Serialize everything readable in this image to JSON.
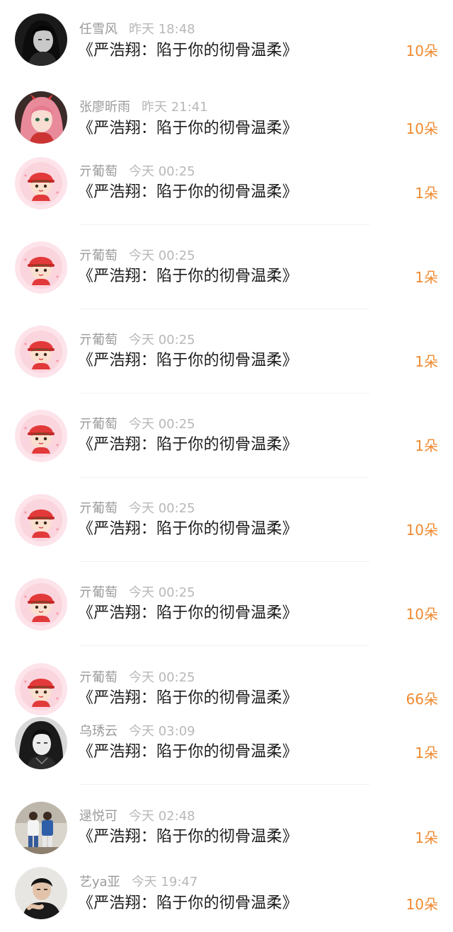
{
  "gift_list": {
    "items": [
      {
        "user": "任雪风",
        "time": "昨天 18:48",
        "title": "《严浩翔：陷于你的彻骨温柔》",
        "count": "10朵",
        "avatar": "dark-portrait"
      },
      {
        "user": "张廖昕雨",
        "time": "昨天 21:41",
        "title": "《严浩翔：陷于你的彻骨温柔》",
        "count": "10朵",
        "avatar": "anime-pink-hair"
      },
      {
        "user": "亓葡萄",
        "time": "今天 00:25",
        "title": "《严浩翔：陷于你的彻骨温柔》",
        "count": "1朵",
        "avatar": "cartoon-red-cap"
      },
      {
        "user": "亓葡萄",
        "time": "今天 00:25",
        "title": "《严浩翔：陷于你的彻骨温柔》",
        "count": "1朵",
        "avatar": "cartoon-red-cap"
      },
      {
        "user": "亓葡萄",
        "time": "今天 00:25",
        "title": "《严浩翔：陷于你的彻骨温柔》",
        "count": "1朵",
        "avatar": "cartoon-red-cap"
      },
      {
        "user": "亓葡萄",
        "time": "今天 00:25",
        "title": "《严浩翔：陷于你的彻骨温柔》",
        "count": "1朵",
        "avatar": "cartoon-red-cap"
      },
      {
        "user": "亓葡萄",
        "time": "今天 00:25",
        "title": "《严浩翔：陷于你的彻骨温柔》",
        "count": "10朵",
        "avatar": "cartoon-red-cap"
      },
      {
        "user": "亓葡萄",
        "time": "今天 00:25",
        "title": "《严浩翔：陷于你的彻骨温柔》",
        "count": "10朵",
        "avatar": "cartoon-red-cap"
      },
      {
        "user": "亓葡萄",
        "time": "今天 00:25",
        "title": "《严浩翔：陷于你的彻骨温柔》",
        "count": "66朵",
        "avatar": "cartoon-red-cap"
      },
      {
        "user": "乌琇云",
        "time": "今天 03:09",
        "title": "《严浩翔：陷于你的彻骨温柔》",
        "count": "1朵",
        "avatar": "ink-style-character"
      },
      {
        "user": "逯悦可",
        "time": "今天 02:48",
        "title": "《严浩翔：陷于你的彻骨温柔》",
        "count": "1朵",
        "avatar": "two-people-photo"
      },
      {
        "user": "艺ya亚",
        "time": "今天 19:47",
        "title": "《严浩翔：陷于你的彻骨温柔》",
        "count": "10朵",
        "avatar": "young-man-photo"
      }
    ]
  },
  "colors": {
    "count_accent": "#f08a30",
    "meta_text": "#9a9a9a",
    "title_text": "#1c1c1c"
  }
}
